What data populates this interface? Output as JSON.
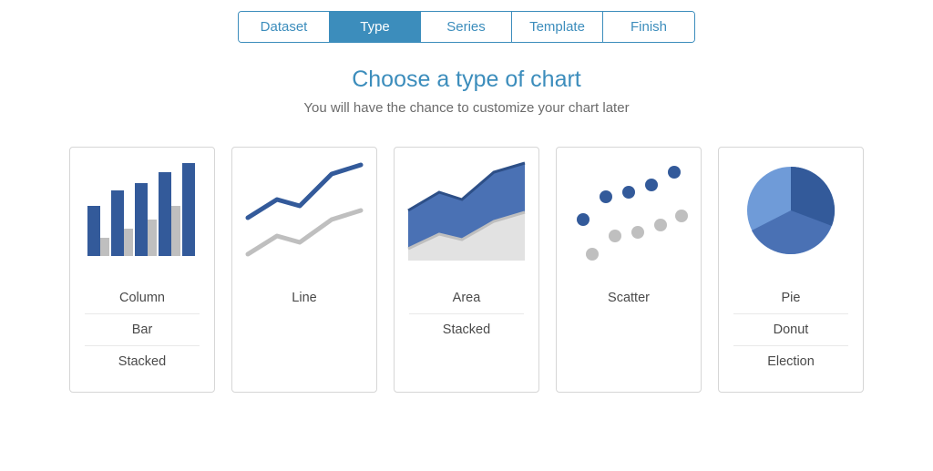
{
  "tabs": [
    {
      "label": "Dataset",
      "active": false
    },
    {
      "label": "Type",
      "active": true
    },
    {
      "label": "Series",
      "active": false
    },
    {
      "label": "Template",
      "active": false
    },
    {
      "label": "Finish",
      "active": false
    }
  ],
  "header": {
    "title": "Choose a type of chart",
    "subtitle": "You will have the chance to customize your chart later"
  },
  "chart_types": [
    {
      "name": "column",
      "options": [
        "Column",
        "Bar",
        "Stacked"
      ]
    },
    {
      "name": "line",
      "options": [
        "Line"
      ]
    },
    {
      "name": "area",
      "options": [
        "Area",
        "Stacked"
      ]
    },
    {
      "name": "scatter",
      "options": [
        "Scatter"
      ]
    },
    {
      "name": "pie",
      "options": [
        "Pie",
        "Donut",
        "Election"
      ]
    }
  ],
  "colors": {
    "accent": "#3c8dbc",
    "dark_blue": "#335a9a",
    "mid_blue": "#4a71b4",
    "light_blue": "#6f9bd8",
    "grey": "#bfbfbf",
    "light_grey": "#e2e2e2"
  }
}
